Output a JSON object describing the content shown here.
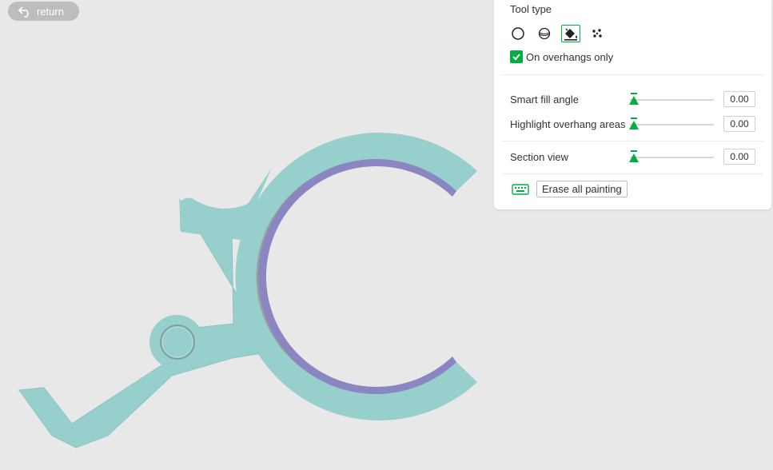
{
  "return_button": {
    "label": "return",
    "icon": "undo-arrow-icon"
  },
  "panel": {
    "tool_type_label": "Tool type",
    "tools": [
      {
        "name": "circle-tool-icon",
        "selected": false
      },
      {
        "name": "sphere-tool-icon",
        "selected": false
      },
      {
        "name": "fill-bucket-tool-icon",
        "selected": true
      },
      {
        "name": "gap-fill-tool-icon",
        "selected": false
      }
    ],
    "overhangs_only": {
      "label": "On overhangs only",
      "checked": true
    },
    "sliders": [
      {
        "label": "Smart fill angle",
        "value": "0.00",
        "fraction": 0
      },
      {
        "label": "Highlight overhang areas",
        "value": "0.00",
        "fraction": 0
      },
      {
        "label": "Section view",
        "value": "0.00",
        "fraction": 0
      }
    ],
    "erase_button": "Erase all painting",
    "keyboard_icon": "keyboard-icon"
  },
  "colors": {
    "accent": "#00ae42",
    "model": "#97cfcc",
    "inner_band": "#8a86c2",
    "background": "#e8e8e8"
  }
}
